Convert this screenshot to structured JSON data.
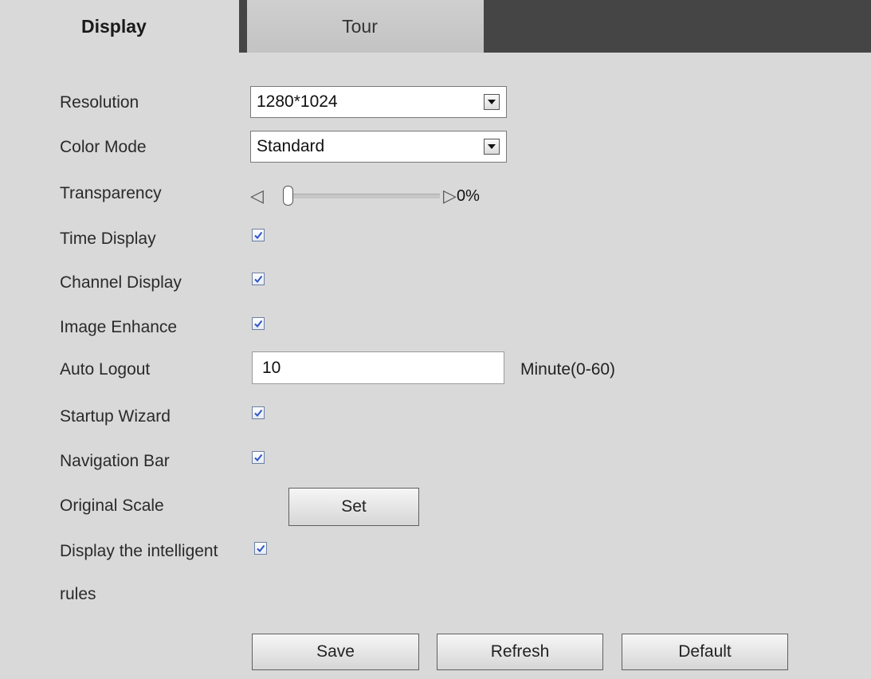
{
  "tabs": {
    "display": "Display",
    "tour": "Tour"
  },
  "fields": {
    "resolution": {
      "label": "Resolution",
      "value": "1280*1024"
    },
    "color_mode": {
      "label": "Color Mode",
      "value": "Standard"
    },
    "transparency": {
      "label": "Transparency",
      "value_text": "0%",
      "value": 0
    },
    "time_display": {
      "label": "Time Display",
      "checked": true
    },
    "channel_display": {
      "label": "Channel Display",
      "checked": true
    },
    "image_enhance": {
      "label": "Image Enhance",
      "checked": true
    },
    "auto_logout": {
      "label": "Auto Logout",
      "value": "10",
      "unit": "Minute(0-60)"
    },
    "startup_wizard": {
      "label": "Startup Wizard",
      "checked": true
    },
    "navigation_bar": {
      "label": "Navigation Bar",
      "checked": true
    },
    "original_scale": {
      "label": "Original Scale",
      "button": "Set"
    },
    "intelligent_rules": {
      "label_line1": "Display the intelligent",
      "label_line2": "rules",
      "checked": true
    }
  },
  "buttons": {
    "save": "Save",
    "refresh": "Refresh",
    "default": "Default"
  },
  "colors": {
    "background": "#d9d9d9",
    "tabbar_dark": "#454545",
    "check_color": "#2f55c8"
  }
}
